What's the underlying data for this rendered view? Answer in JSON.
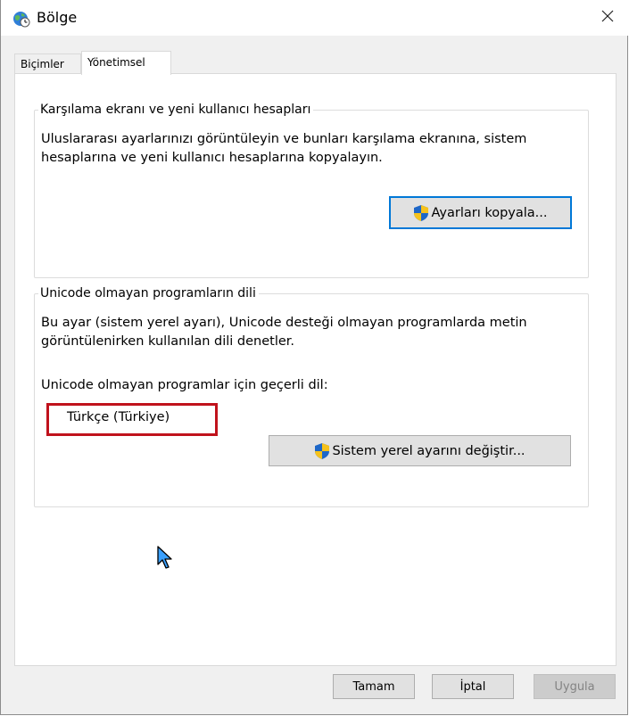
{
  "window": {
    "title": "Bölge",
    "icon": "globe-clock-icon",
    "close_icon": "close-icon"
  },
  "tabs": [
    {
      "label": "Biçimler",
      "active": false
    },
    {
      "label": "Yönetimsel",
      "active": true
    }
  ],
  "welcome_group": {
    "title": "Karşılama ekranı ve yeni kullanıcı hesapları",
    "description_line1": "Uluslararası ayarlarınızı görüntüleyin ve bunları karşılama ekranına, sistem",
    "description_line2": "hesaplarına ve yeni kullanıcı hesaplarına kopyalayın.",
    "button_label": "Ayarları kopyala..."
  },
  "unicode_group": {
    "title": "Unicode olmayan programların dili",
    "description_line1": "Bu ayar (sistem yerel ayarı), Unicode desteği olmayan programlarda metin",
    "description_line2": "görüntülenirken kullanılan dili denetler.",
    "current_label": "Unicode olmayan programlar için geçerli dil:",
    "current_value": "Türkçe (Türkiye)",
    "button_label": "Sistem yerel ayarını değiştir..."
  },
  "footer": {
    "ok_label": "Tamam",
    "cancel_label": "İptal",
    "apply_label": "Uygula"
  },
  "colors": {
    "accent": "#0078d7",
    "highlight": "#c0121c",
    "shield_blue": "#1e67c8",
    "shield_yellow": "#f6c21c"
  }
}
